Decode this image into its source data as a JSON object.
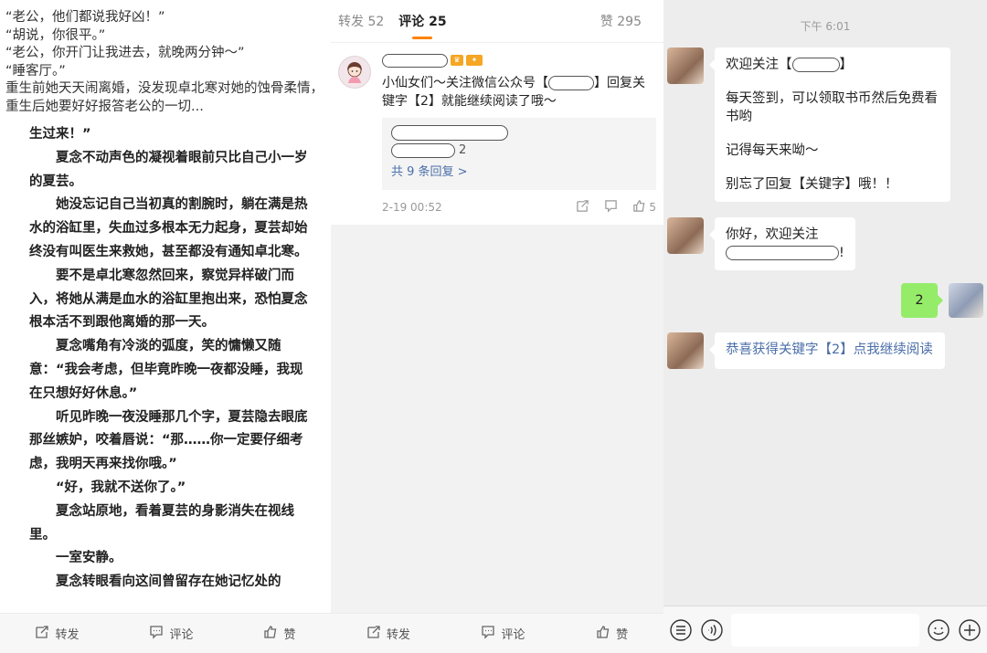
{
  "novel": {
    "intro_lines": [
      "“老公，他们都说我好凶！”",
      "“胡说，你很平。”",
      "“老公，你开门让我进去，就晚两分钟～”",
      "“睡客厅。”",
      "重生前她天天闹离婚，没发现卓北寒对她的蚀骨柔情，重生后她要好好报答老公的一切..."
    ],
    "paragraphs": [
      "生过来！”",
      "夏念不动声色的凝视着眼前只比自己小一岁的夏芸。",
      "她没忘记自己当初真的割腕时，躺在满是热水的浴缸里，失血过多根本无力起身，夏芸却始终没有叫医生来救她，甚至都没有通知卓北寒。",
      "要不是卓北寒忽然回来，察觉异样破门而入，将她从满是血水的浴缸里抱出来，恐怕夏念根本活不到跟他离婚的那一天。",
      "夏念嘴角有冷淡的弧度，笑的慵懒又随意：“我会考虑，但毕竟昨晚一夜都没睡，我现在只想好好休息。”",
      "听见昨晚一夜没睡那几个字，夏芸隐去眼底那丝嫉妒，咬着唇说：“那……你一定要仔细考虑，我明天再来找你哦。”",
      "“好，我就不送你了。”",
      "夏念站原地，看着夏芸的身影消失在视线里。",
      "一室安静。",
      "夏念转眼看向这间曾留存在她记忆处的"
    ]
  },
  "toolbar": {
    "repost": "转发",
    "comment": "评论",
    "like": "赞"
  },
  "comments_panel": {
    "tabs": {
      "repost": "转发 52",
      "comment": "评论 25",
      "like": "赞 295"
    },
    "comment": {
      "text": "小仙女们～关注微信公众号【",
      "text_tail": "】回复关键字【2】就能继续阅读了哦～",
      "reply_count": "2",
      "more_replies": "共 9 条回复 >",
      "time": "2-19 00:52",
      "like_count": "5"
    }
  },
  "chat": {
    "time": "下午 6:01",
    "msg1": {
      "line1_prefix": "欢迎关注【",
      "line1_suffix": "】",
      "line2": "每天签到，可以领取书币然后免费看书哟",
      "line3": "记得每天来呦～",
      "line4": "别忘了回复【关键字】哦！！"
    },
    "msg2": {
      "line1": "你好，欢迎关注",
      "tail": "!"
    },
    "msg3": "2",
    "msg4": "恭喜获得关键字【2】点我继续阅读"
  },
  "colors": {
    "accent_orange": "#ff8200",
    "link_blue": "#4a6ea8",
    "wechat_green": "#95ec69"
  }
}
